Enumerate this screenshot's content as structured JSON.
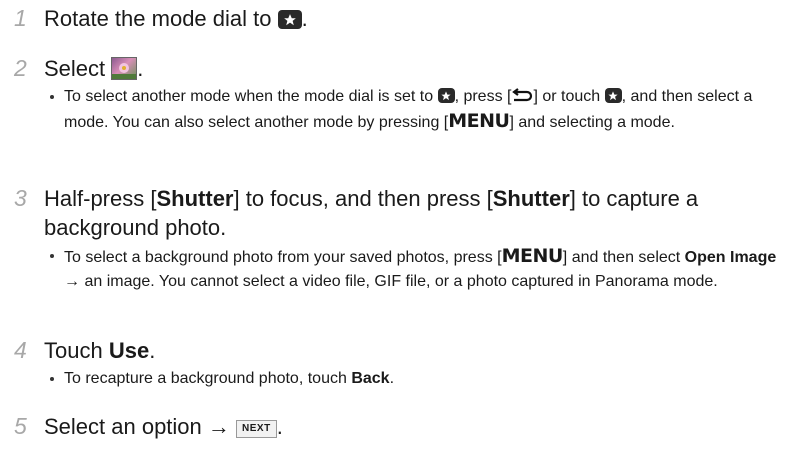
{
  "steps": [
    {
      "num": "1",
      "text_before": "Rotate the mode dial to",
      "text_after": "."
    },
    {
      "num": "2",
      "text_before": "Select",
      "text_after": ".",
      "bullets": [
        {
          "t1": "To select another mode when the mode dial is set to",
          "t2": ", press [",
          "t3": "] or touch",
          "t4": ", and then select a mode. You can also select another mode by pressing [",
          "menu": "MENU",
          "t5": "] and selecting a mode."
        }
      ]
    },
    {
      "num": "3",
      "t1": "Half-press [",
      "shutter": "Shutter",
      "t2": "] to focus, and then press [",
      "t3": "] to capture a background photo.",
      "bullets": [
        {
          "t1": "To select a background photo from your saved photos, press [",
          "menu": "MENU",
          "t2": "] and then select",
          "open_image": "Open Image",
          "t3": "→ an image. You cannot select a video file, GIF file, or a photo captured in Panorama mode."
        }
      ]
    },
    {
      "num": "4",
      "t1": "Touch",
      "use": "Use",
      "t2": ".",
      "bullets": [
        {
          "t1": "To recapture a background photo, touch",
          "back": "Back",
          "t2": "."
        }
      ]
    },
    {
      "num": "5",
      "t1": "Select an option →",
      "next": "NEXT",
      "t2": "."
    }
  ],
  "icons": {
    "star_mode": "star-mode-icon",
    "photo_frame": "photo-frame-icon",
    "back": "back-icon"
  },
  "colors": {
    "step_number": "#a8a8a8",
    "text": "#1a1a1a"
  }
}
